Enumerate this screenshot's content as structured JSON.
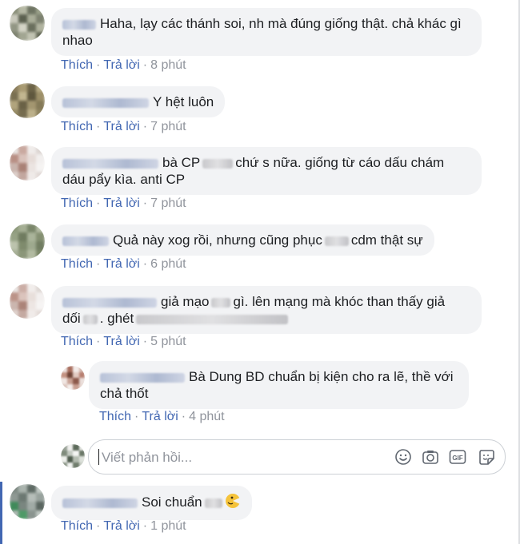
{
  "comments": [
    {
      "text_a": "Haha, lạy các thánh soi, nh mà đúng giống thật. chả khác gì",
      "text_b": "nhao",
      "like_label": "Thích",
      "reply_label": "Trả lời",
      "time": "8 phút"
    },
    {
      "text_a": "Y hệt luôn",
      "like_label": "Thích",
      "reply_label": "Trả lời",
      "time": "7 phút"
    },
    {
      "text_a1": "bà CP",
      "text_a2": "chứ s nữa. giống từ cáo dấu chám",
      "text_b": "dáu pẩy kìa. anti CP",
      "like_label": "Thích",
      "reply_label": "Trả lời",
      "time": "7 phút"
    },
    {
      "text_a1": "Quả này xog rồi, nhưng cũng phục",
      "text_a2": "cdm thật sự",
      "like_label": "Thích",
      "reply_label": "Trả lời",
      "time": "6 phút"
    },
    {
      "text_a1": "giả mạo",
      "text_a2": "gì. lên mạng mà khóc than thấy giả",
      "text_b1": "dối",
      "text_b2": ". ghét",
      "like_label": "Thích",
      "reply_label": "Trả lời",
      "time": "5 phút"
    },
    {
      "text_a": "Bà Dung BD chuẩn bị kiện cho ra lẽ, thề với",
      "text_b": "chả thốt",
      "like_label": "Thích",
      "reply_label": "Trả lời",
      "time": "4 phút"
    },
    {
      "text_a": "Soi chuẩn",
      "like_label": "Thích",
      "reply_label": "Trả lời",
      "time": "1 phút"
    }
  ],
  "reply_box": {
    "placeholder": "Viết phản hồi...",
    "icons": [
      "smile-emoji-icon",
      "camera-icon",
      "gif-icon",
      "sticker-icon"
    ],
    "gif_label": "GIF"
  },
  "colors": {
    "link": "#4267b2",
    "bubble": "#f2f3f5",
    "meta": "#90949c",
    "text": "#1c1e21"
  }
}
